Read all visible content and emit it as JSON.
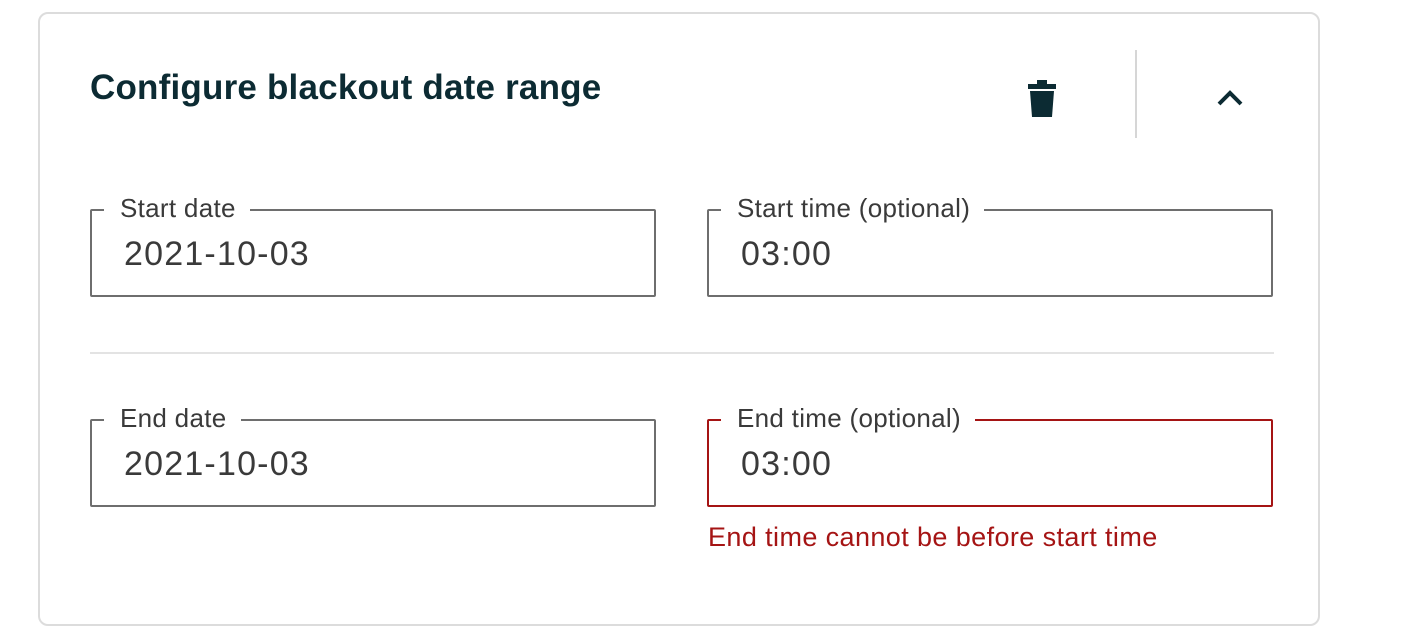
{
  "panel": {
    "title": "Configure blackout date range",
    "delete_icon": "trash-icon",
    "collapse_icon": "chevron-up-icon"
  },
  "fields": {
    "start_date": {
      "label": "Start date",
      "value": "2021-10-03"
    },
    "start_time": {
      "label": "Start time (optional)",
      "value": "03:00"
    },
    "end_date": {
      "label": "End date",
      "value": "2021-10-03"
    },
    "end_time": {
      "label": "End time (optional)",
      "value": "03:00",
      "error": "End time cannot be before start time"
    }
  },
  "colors": {
    "title": "#0c2b33",
    "error": "#a51414",
    "border": "#6e6e6e",
    "card_border": "#dcdcdc"
  }
}
